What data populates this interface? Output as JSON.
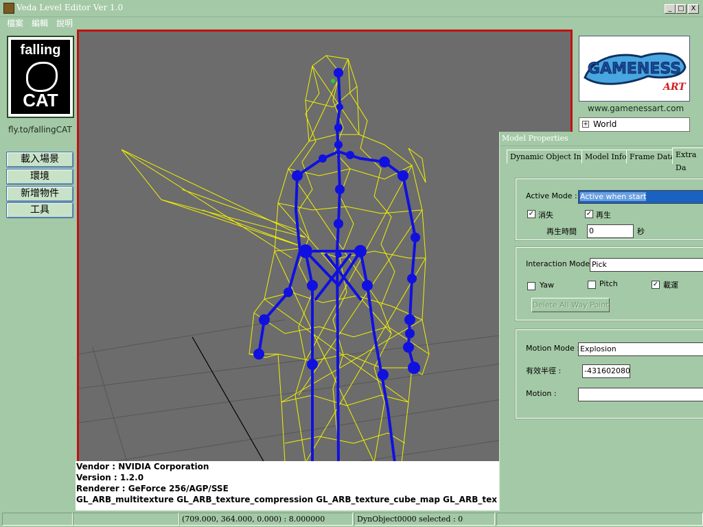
{
  "window": {
    "title": "Veda Level Editor Ver 1.0",
    "controls": [
      "_",
      "□",
      "X"
    ]
  },
  "menu": [
    "檔案",
    "編輯",
    "說明"
  ],
  "left_panel": {
    "logo_top": "falling",
    "logo_bottom": "CAT",
    "site": "fly.to/fallingCAT",
    "buttons": [
      "載入場景",
      "環境",
      "新增物件",
      "工具"
    ]
  },
  "right_panel": {
    "logo_text": "GAMENESS",
    "logo_sub": "ART",
    "site": "www.gamenessart.com",
    "tree_item": "World"
  },
  "viewport_info": [
    "Vendor : NVIDIA Corporation",
    "Version : 1.2.0",
    "Renderer : GeForce 256/AGP/SSE",
    "GL_ARB_multitexture GL_ARB_texture_compression GL_ARB_texture_cube_map GL_ARB_tex"
  ],
  "properties": {
    "title": "Model Properties",
    "tabs": [
      "Dynamic Object Info",
      "Model Info",
      "Frame Data",
      "Extra Da"
    ],
    "active_tab": "Extra Da",
    "active_mode_label": "Active Mode :",
    "active_mode_value": "Active when start",
    "vanish_label": "消失",
    "vanish_checked": true,
    "respawn_label": "再生",
    "respawn_checked": true,
    "respawn_time_label": "再生時間",
    "respawn_time_value": "0",
    "respawn_time_unit": "秒",
    "interaction_mode_label": "Interaction Mode :",
    "interaction_mode_value": "Pick",
    "yaw_label": "Yaw",
    "yaw_checked": false,
    "pitch_label": "Pitch",
    "pitch_checked": false,
    "carry_label": "載運",
    "carry_checked": true,
    "delete_waypoint_label": "Delete All Way Point",
    "motion_mode_label": "Motion Mode :",
    "motion_mode_value": "Explosion",
    "radius_label": "有效半徑 :",
    "radius_value": "-431602080.0",
    "motion_label": "Motion :",
    "motion_value": ""
  },
  "status_bar": {
    "cell1": "",
    "cell2": "",
    "coords": "(709.000, 364.000, 0.000) : 8.000000",
    "selection": "DynObject0000 selected : 0",
    "cell5": ""
  },
  "colors": {
    "background": "#a4c9a6",
    "viewport_border": "#c41010",
    "wireframe": "#f2f200",
    "skeleton": "#1010e0"
  }
}
